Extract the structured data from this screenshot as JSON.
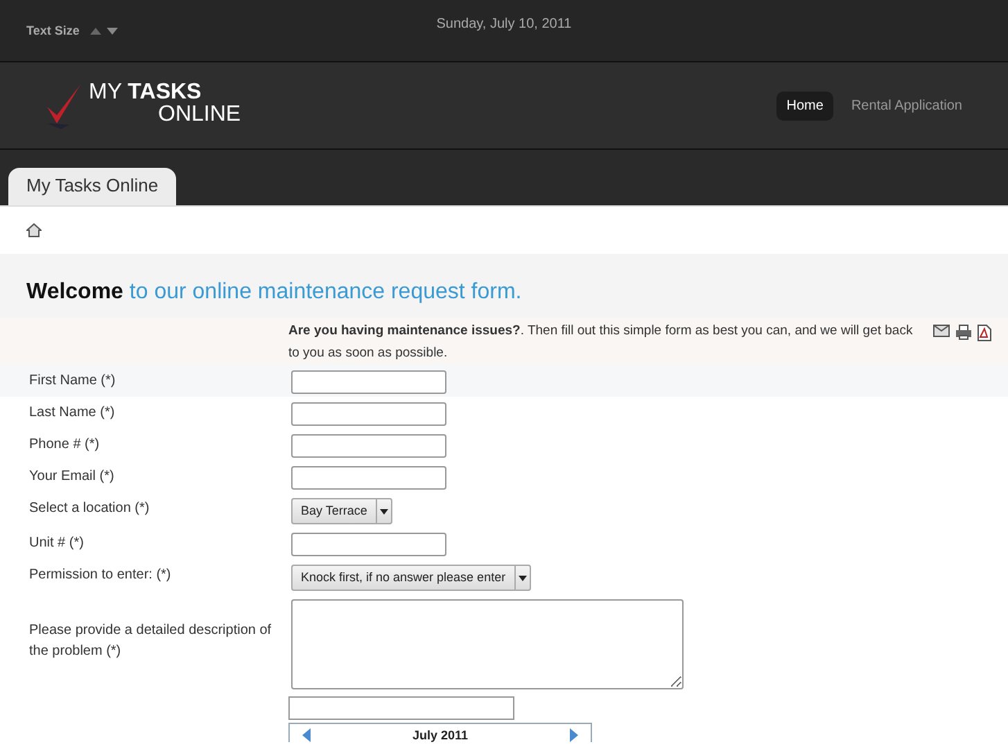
{
  "top_bar": {
    "text_size_label": "Text Size",
    "date": "Sunday, July 10, 2011"
  },
  "logo": {
    "line_1": "MY",
    "line_1_bold": "TASKS",
    "line_2": "ONLINE"
  },
  "nav": [
    {
      "label": "Home",
      "selected": true
    },
    {
      "label": "Rental Application",
      "selected": false
    }
  ],
  "tabs": [
    {
      "label": "My Tasks Online",
      "selected": true
    }
  ],
  "heading": {
    "lead": "Welcome",
    "rest": "to our online maintenance request form."
  },
  "intro": "**Are you having maintenance issues?**. Then fill out this simple form as best you can, and we will get back to you as soon as possible.",
  "fields": [
    {
      "kind": "text",
      "label": "First Name (*)"
    },
    {
      "kind": "text",
      "label": "Last Name (*)"
    },
    {
      "kind": "text",
      "label": "Phone # (*)"
    },
    {
      "kind": "text",
      "label": "Your Email (*)"
    },
    {
      "kind": "select",
      "label": "Select a location (*)",
      "value": "Bay Terrace"
    },
    {
      "kind": "text",
      "label": "Unit # (*)"
    },
    {
      "kind": "select",
      "label": "Permission to enter: (*)",
      "value": "Knock first, if no answer please enter"
    },
    {
      "kind": "textarea",
      "label": "Please provide a detailed description of the problem (*)"
    }
  ],
  "calendar": {
    "month": "July 2011"
  }
}
